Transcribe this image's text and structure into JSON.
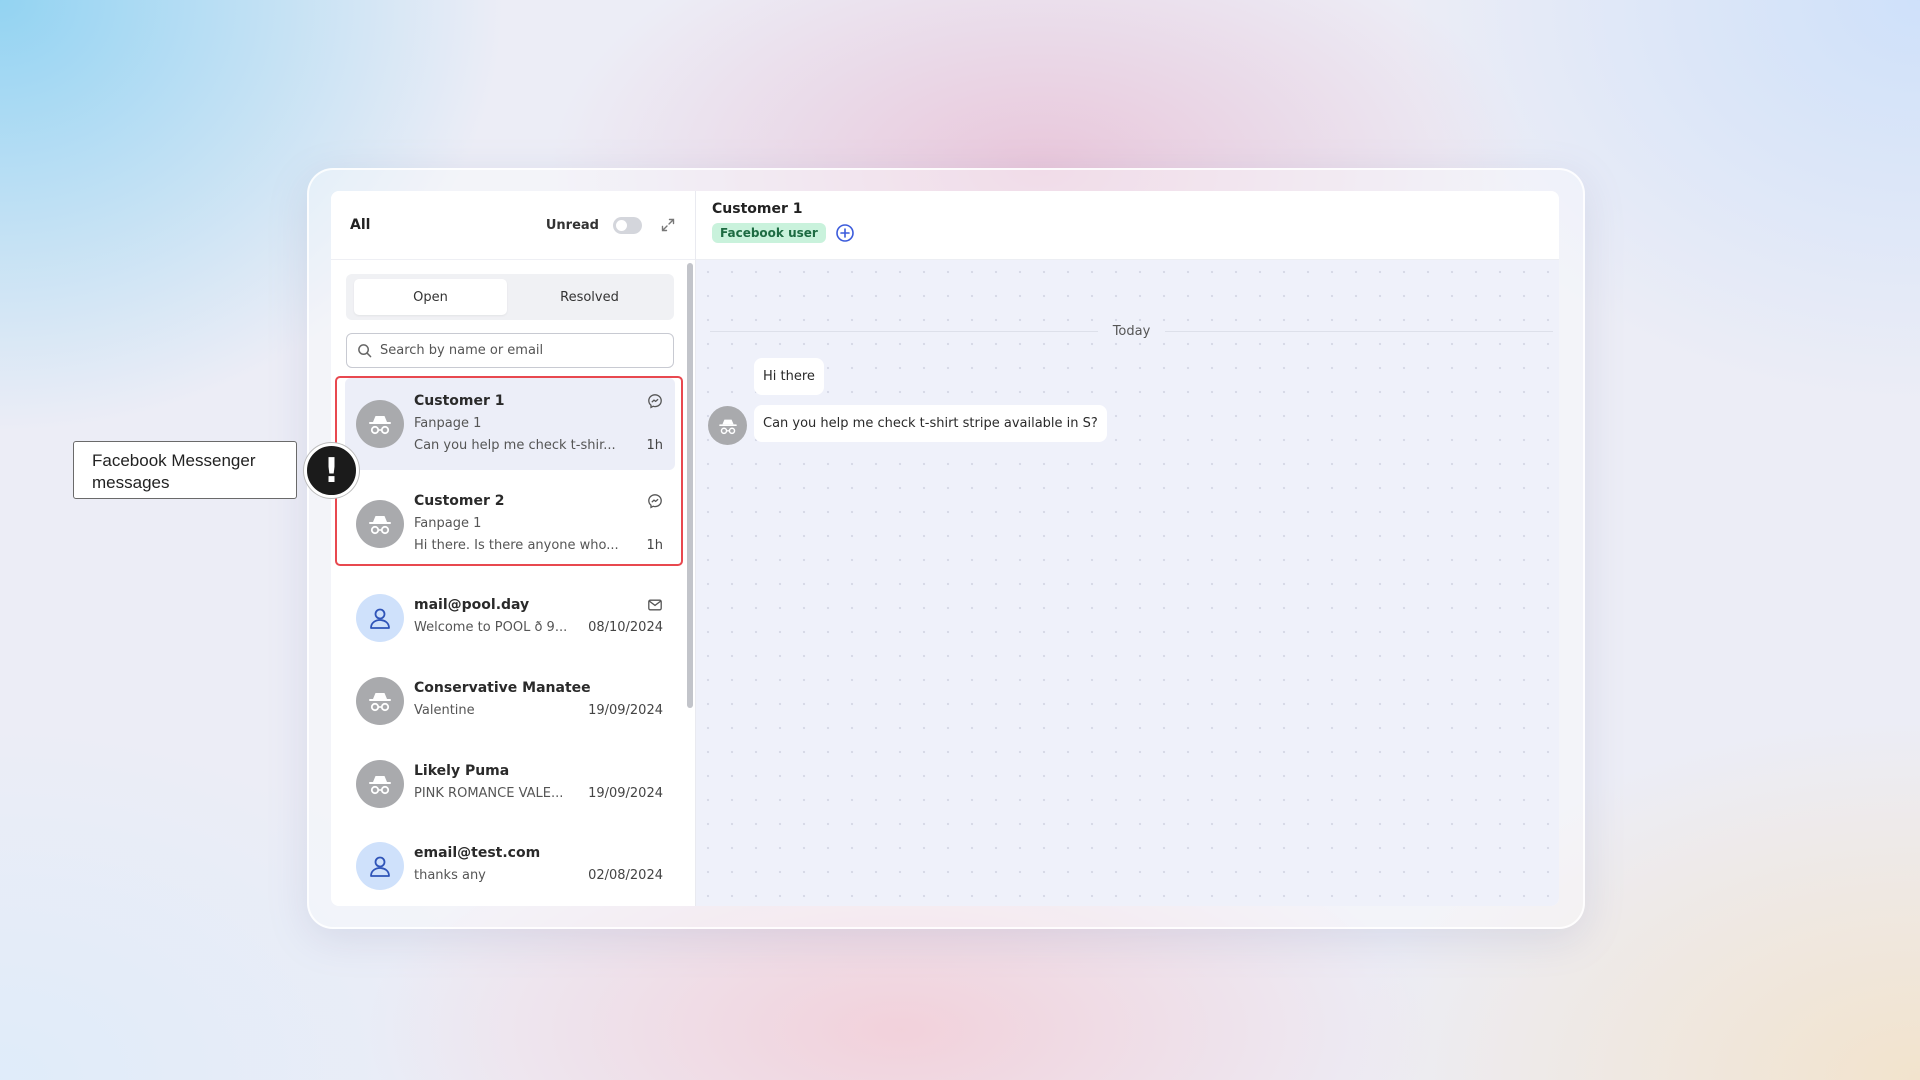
{
  "sidebar": {
    "title": "All",
    "unread_label": "Unread",
    "unread_enabled": false,
    "tabs": [
      {
        "label": "Open",
        "active": true
      },
      {
        "label": "Resolved",
        "active": false
      }
    ],
    "search_placeholder": "Search by name or email",
    "conversations": [
      {
        "name": "Customer 1",
        "source": "Fanpage 1",
        "preview": "Can you help me check t-shir...",
        "time": "1h",
        "channel": "messenger-icon",
        "avatar": "incognito-icon",
        "selected": true
      },
      {
        "name": "Customer 2",
        "source": "Fanpage 1",
        "preview": "Hi there. Is there anyone who...",
        "time": "1h",
        "channel": "messenger-icon",
        "avatar": "incognito-icon",
        "selected": false
      },
      {
        "name": "mail@pool.day",
        "preview": "Welcome to POOL ð 9...",
        "time": "08/10/2024",
        "channel": "mail-icon",
        "avatar": "person-icon",
        "selected": false
      },
      {
        "name": "Conservative Manatee",
        "preview": "Valentine",
        "time": "19/09/2024",
        "avatar": "incognito-icon",
        "selected": false
      },
      {
        "name": "Likely Puma",
        "preview": "PINK ROMANCE VALE...",
        "time": "19/09/2024",
        "avatar": "incognito-icon",
        "selected": false
      },
      {
        "name": "email@test.com",
        "preview": "thanks any",
        "time": "02/08/2024",
        "avatar": "person-icon",
        "selected": false
      }
    ]
  },
  "chat": {
    "contact_name": "Customer 1",
    "tag": "Facebook user",
    "day_label": "Today",
    "messages": [
      {
        "text": "Hi there"
      },
      {
        "text": "Can you help me check t-shirt stripe available in S?"
      }
    ]
  },
  "callout": {
    "text": "Facebook Messenger messages",
    "badge": "!"
  },
  "colors": {
    "highlight": "#e8484f",
    "tag_bg": "#c9f2dc",
    "tag_text": "#1d6b42",
    "accent": "#3b5bdb"
  }
}
